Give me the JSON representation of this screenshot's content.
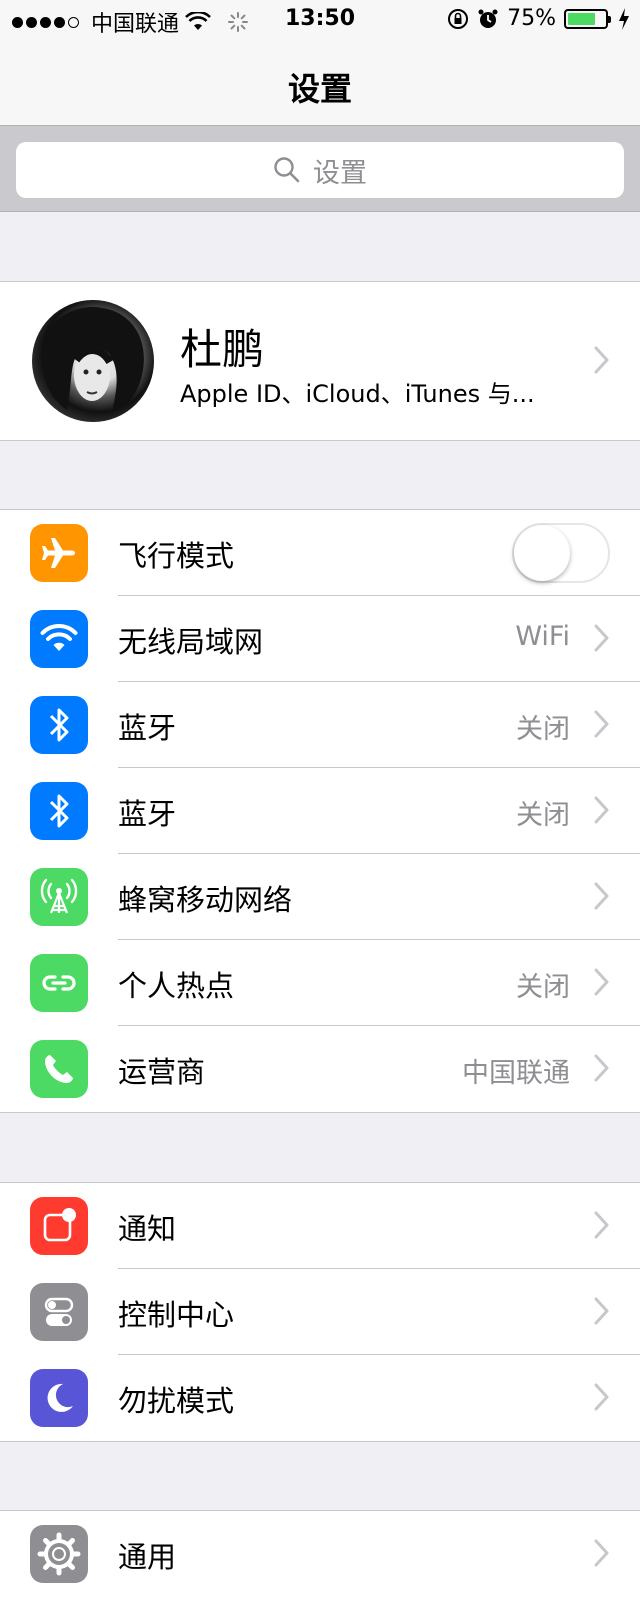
{
  "status_bar": {
    "carrier": "中国联通",
    "time": "13:50",
    "battery_percent": "75%",
    "battery_level": 0.75,
    "signal_bars_filled": 4,
    "signal_bars_total": 5
  },
  "nav": {
    "title": "设置"
  },
  "search": {
    "placeholder": "设置"
  },
  "profile": {
    "name": "杜鹏",
    "subtitle": "Apple ID、iCloud、iTunes 与..."
  },
  "group1": [
    {
      "label": "飞行模式",
      "icon": "airplane-icon",
      "color": "#ff9500",
      "toggle_on": false
    },
    {
      "label": "无线局域网",
      "value": "WiFi",
      "icon": "wifi-icon",
      "color": "#007aff"
    },
    {
      "label": "蓝牙",
      "value": "关闭",
      "icon": "bluetooth-icon",
      "color": "#007aff"
    },
    {
      "label": "蓝牙",
      "value": "关闭",
      "icon": "bluetooth-icon",
      "color": "#007aff"
    },
    {
      "label": "蜂窝移动网络",
      "value": "",
      "icon": "cellular-icon",
      "color": "#4cd964"
    },
    {
      "label": "个人热点",
      "value": "关闭",
      "icon": "hotspot-icon",
      "color": "#4cd964"
    },
    {
      "label": "运营商",
      "value": "中国联通",
      "icon": "phone-icon",
      "color": "#4cd964"
    }
  ],
  "group2": [
    {
      "label": "通知",
      "icon": "notifications-icon",
      "color": "#ff3b30"
    },
    {
      "label": "控制中心",
      "icon": "control-center-icon",
      "color": "#8e8e93"
    },
    {
      "label": "勿扰模式",
      "icon": "moon-icon",
      "color": "#5856d6"
    }
  ],
  "group3": [
    {
      "label": "通用",
      "icon": "gear-icon",
      "color": "#8e8e93"
    }
  ]
}
